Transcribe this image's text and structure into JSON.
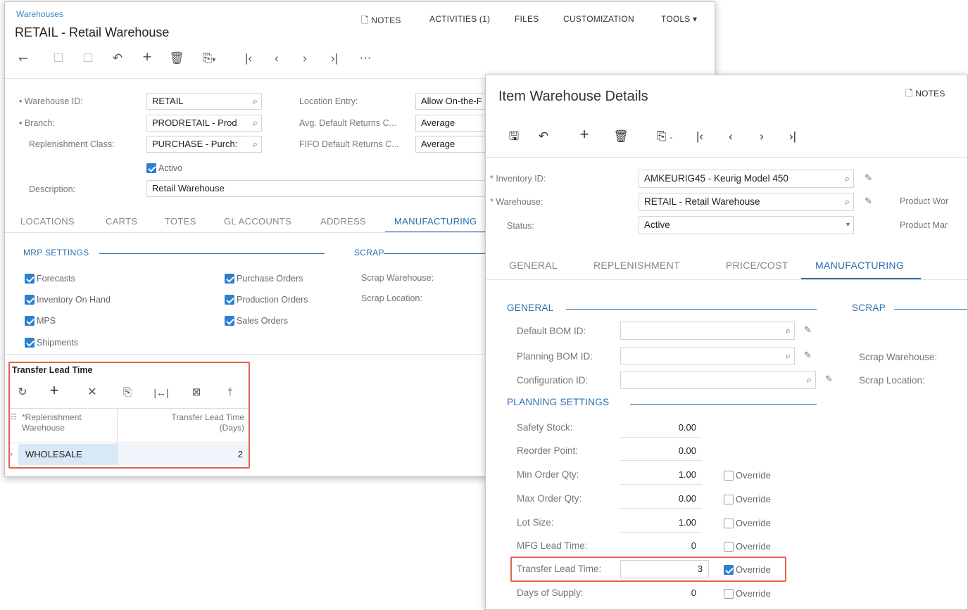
{
  "back": {
    "breadcrumb": "Warehouses",
    "title": "RETAIL - Retail Warehouse",
    "topnav": {
      "notes": "NOTES",
      "activities": "ACTIVITIES (1)",
      "files": "FILES",
      "customization": "CUSTOMIZATION",
      "tools": "TOOLS"
    },
    "form": {
      "warehouse_id_label": "Warehouse ID:",
      "warehouse_id_value": "RETAIL",
      "branch_label": "Branch:",
      "branch_value": "PRODRETAIL - Prod",
      "replenishment_class_label": "Replenishment Class:",
      "replenishment_class_value": "PURCHASE - Purch:",
      "active_label": "Activo",
      "description_label": "Description:",
      "description_value": "Retail Warehouse",
      "location_entry_label": "Location Entry:",
      "location_entry_value": "Allow On-the-F",
      "avg_returns_label": "Avg. Default Returns C...",
      "avg_returns_value": "Average",
      "fifo_returns_label": "FIFO Default Returns C...",
      "fifo_returns_value": "Average"
    },
    "tabs": [
      "LOCATIONS",
      "CARTS",
      "TOTES",
      "GL ACCOUNTS",
      "ADDRESS",
      "MANUFACTURING"
    ],
    "mrp": {
      "title": "MRP SETTINGS",
      "items": [
        {
          "label": "Forecasts",
          "checked": true
        },
        {
          "label": "Inventory On Hand",
          "checked": true
        },
        {
          "label": "MPS",
          "checked": true
        },
        {
          "label": "Shipments",
          "checked": true
        },
        {
          "label": "Purchase Orders",
          "checked": true
        },
        {
          "label": "Production Orders",
          "checked": true
        },
        {
          "label": "Sales Orders",
          "checked": true
        }
      ]
    },
    "scrap": {
      "title": "SCRAP",
      "warehouse_label": "Scrap Warehouse:",
      "location_label": "Scrap Location:"
    },
    "transfer": {
      "title": "Transfer Lead Time",
      "col1": "Replenishment Warehouse",
      "col2": "Transfer Lead Time (Days)",
      "row_warehouse": "WHOLESALE",
      "row_days": "2"
    }
  },
  "front": {
    "title": "Item Warehouse Details",
    "notes": "NOTES",
    "inventory_id_label": "Inventory ID:",
    "inventory_id_value": "AMKEURIG45 - Keurig Model 450",
    "warehouse_label": "Warehouse:",
    "warehouse_value": "RETAIL - Retail Warehouse",
    "status_label": "Status:",
    "status_value": "Active",
    "product_wor": "Product Wor",
    "product_mar": "Product Mar",
    "tabs": [
      "GENERAL",
      "REPLENISHMENT",
      "PRICE/COST",
      "MANUFACTURING"
    ],
    "general_title": "GENERAL",
    "scrap_title": "SCRAP",
    "default_bom_label": "Default BOM ID:",
    "planning_bom_label": "Planning BOM ID:",
    "configuration_label": "Configuration ID:",
    "scrap_warehouse_label": "Scrap Warehouse:",
    "scrap_location_label": "Scrap Location:",
    "planning_title": "PLANNING SETTINGS",
    "override": "Override",
    "planning": {
      "safety_stock_label": "Safety Stock:",
      "safety_stock": "0.00",
      "reorder_point_label": "Reorder Point:",
      "reorder_point": "0.00",
      "min_order_label": "Min Order Qty:",
      "min_order": "1.00",
      "max_order_label": "Max Order Qty:",
      "max_order": "0.00",
      "lot_size_label": "Lot Size:",
      "lot_size": "1.00",
      "mfg_lead_label": "MFG Lead Time:",
      "mfg_lead": "0",
      "transfer_lead_label": "Transfer Lead Time:",
      "transfer_lead": "3",
      "days_supply_label": "Days of Supply:",
      "days_supply": "0"
    }
  },
  "colors": {
    "accent": "#2a6fb0",
    "highlight_box": "#e06548",
    "checkbox": "#2d7fd0"
  }
}
